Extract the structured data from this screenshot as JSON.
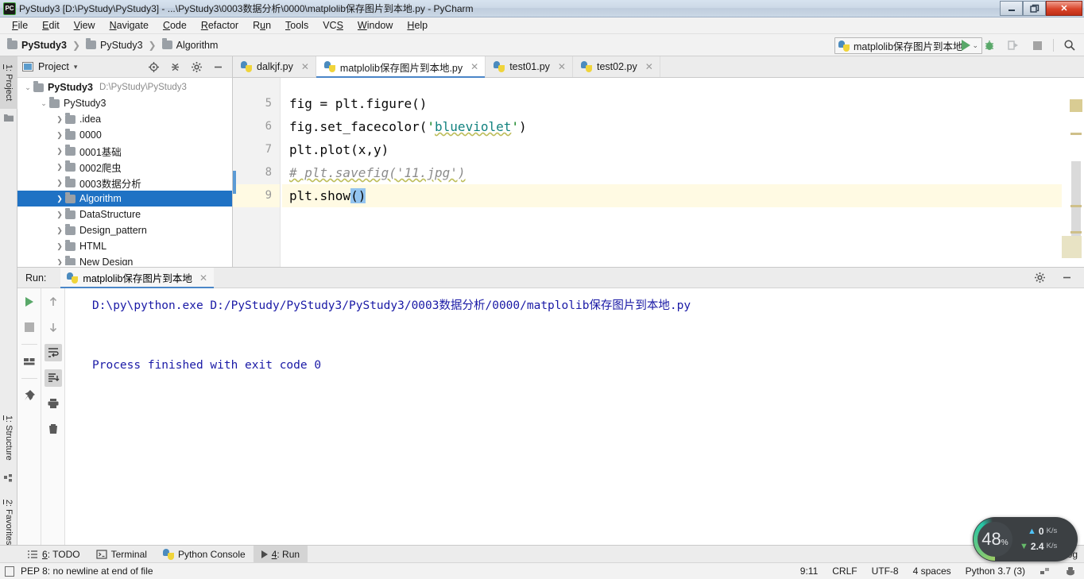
{
  "window": {
    "title": "PyStudy3 [D:\\PyStudy\\PyStudy3] - ...\\PyStudy3\\0003数据分析\\0000\\matplolib保存图片到本地.py - PyCharm",
    "app_icon": "PC",
    "minimize_label": "—",
    "restore_label": "❐",
    "close_label": "✕"
  },
  "menubar": {
    "items": [
      {
        "label": "File",
        "mnemonic": "F"
      },
      {
        "label": "Edit",
        "mnemonic": "E"
      },
      {
        "label": "View",
        "mnemonic": "V"
      },
      {
        "label": "Navigate",
        "mnemonic": "N"
      },
      {
        "label": "Code",
        "mnemonic": "C"
      },
      {
        "label": "Refactor",
        "mnemonic": "R"
      },
      {
        "label": "Run",
        "mnemonic": "u"
      },
      {
        "label": "Tools",
        "mnemonic": "T"
      },
      {
        "label": "VCS",
        "mnemonic": "S"
      },
      {
        "label": "Window",
        "mnemonic": "W"
      },
      {
        "label": "Help",
        "mnemonic": "H"
      }
    ]
  },
  "breadcrumb": {
    "items": [
      "PyStudy3",
      "PyStudy3",
      "Algorithm"
    ],
    "separator": "❯"
  },
  "run_config": {
    "name": "matplolib保存图片到本地",
    "chevron": "⌄",
    "icon": "python-icon"
  },
  "nav_actions": [
    {
      "name": "run-button",
      "icon": "play-icon"
    },
    {
      "name": "debug-button",
      "icon": "bug-icon"
    },
    {
      "name": "run-coverage-button",
      "icon": "coverage-icon"
    },
    {
      "name": "stop-button",
      "icon": "stop-icon"
    },
    {
      "name": "search-everywhere-button",
      "icon": "search-icon"
    }
  ],
  "left_strip": {
    "top": {
      "label": "1: Project",
      "mnemonic": "1"
    },
    "bottom": [
      {
        "label": "1: Structure",
        "mnemonic": "1"
      },
      {
        "label": "2: Favorites",
        "mnemonic": "2"
      }
    ]
  },
  "project_panel": {
    "title": "Project",
    "dropdown": "▾",
    "tools": [
      {
        "name": "locate-icon",
        "label": "Select Opened File"
      },
      {
        "name": "collapse-all-icon",
        "label": "Collapse All"
      },
      {
        "name": "gear-icon",
        "label": "Settings"
      },
      {
        "name": "hide-icon",
        "label": "Hide"
      }
    ],
    "tree": [
      {
        "indent": 0,
        "arrow": "⌄",
        "label": "PyStudy3",
        "bold": true,
        "path": "D:\\PyStudy\\PyStudy3",
        "selected": false
      },
      {
        "indent": 1,
        "arrow": "⌄",
        "label": "PyStudy3",
        "bold": false,
        "path": "",
        "selected": false
      },
      {
        "indent": 2,
        "arrow": "❯",
        "label": ".idea",
        "bold": false,
        "path": "",
        "selected": false
      },
      {
        "indent": 2,
        "arrow": "❯",
        "label": "0000",
        "bold": false,
        "path": "",
        "selected": false
      },
      {
        "indent": 2,
        "arrow": "❯",
        "label": "0001基础",
        "bold": false,
        "path": "",
        "selected": false
      },
      {
        "indent": 2,
        "arrow": "❯",
        "label": "0002爬虫",
        "bold": false,
        "path": "",
        "selected": false
      },
      {
        "indent": 2,
        "arrow": "❯",
        "label": "0003数据分析",
        "bold": false,
        "path": "",
        "selected": false
      },
      {
        "indent": 2,
        "arrow": "❯",
        "label": "Algorithm",
        "bold": false,
        "path": "",
        "selected": true
      },
      {
        "indent": 2,
        "arrow": "❯",
        "label": "DataStructure",
        "bold": false,
        "path": "",
        "selected": false
      },
      {
        "indent": 2,
        "arrow": "❯",
        "label": "Design_pattern",
        "bold": false,
        "path": "",
        "selected": false
      },
      {
        "indent": 2,
        "arrow": "❯",
        "label": "HTML",
        "bold": false,
        "path": "",
        "selected": false
      },
      {
        "indent": 2,
        "arrow": "❯",
        "label": "New Design",
        "bold": false,
        "path": "",
        "selected": false
      }
    ]
  },
  "editor": {
    "tabs": [
      {
        "label": "dalkjf.py",
        "active": false,
        "close": "✕"
      },
      {
        "label": "matplolib保存图片到本地.py",
        "active": true,
        "close": "✕"
      },
      {
        "label": "test01.py",
        "active": false,
        "close": "✕"
      },
      {
        "label": "test02.py",
        "active": false,
        "close": "✕"
      }
    ],
    "line_numbers": [
      "5",
      "6",
      "7",
      "8",
      "9"
    ],
    "lines": [
      {
        "num": "5",
        "text": "fig = plt.figure()",
        "current": false
      },
      {
        "num": "6",
        "text": "fig.set_facecolor('blueviolet')",
        "current": false
      },
      {
        "num": "7",
        "text": "plt.plot(x,y)",
        "current": false
      },
      {
        "num": "8",
        "text": "# plt.savefig('11.jpg')",
        "current": false
      },
      {
        "num": "9",
        "text": "plt.show()",
        "current": true
      }
    ],
    "code_tokens": {
      "l5_a": "fig = plt.figure()",
      "l6_a": "fig.set_facecolor(",
      "l6_q1": "'",
      "l6_str": "blueviolet",
      "l6_q2": "'",
      "l6_b": ")",
      "l7_a": "plt.plot(x,y)",
      "l8_comment": "# plt.savefig('11.jpg')",
      "l9_a": "plt.show",
      "l9_sel": "()"
    }
  },
  "run_panel": {
    "label": "Run:",
    "tab_name": "matplolib保存图片到本地",
    "tab_close": "✕",
    "header_tools": [
      {
        "name": "gear-icon"
      },
      {
        "name": "hide-icon"
      }
    ],
    "toolbar": [
      {
        "name": "rerun-button",
        "icon": "play-icon"
      },
      {
        "name": "stop-button",
        "icon": "stop-icon"
      },
      {
        "name": "layout-button",
        "icon": "layout-icon"
      },
      {
        "name": "pin-button",
        "icon": "pin-icon"
      },
      {
        "name": "up-button",
        "icon": "arrow-up-icon"
      },
      {
        "name": "down-button",
        "icon": "arrow-down-icon"
      },
      {
        "name": "soft-wrap-button",
        "icon": "wrap-icon"
      },
      {
        "name": "scroll-to-end-button",
        "icon": "scroll-end-icon"
      },
      {
        "name": "print-button",
        "icon": "printer-icon"
      },
      {
        "name": "clear-all-button",
        "icon": "trash-icon"
      }
    ],
    "console_lines": [
      "D:\\py\\python.exe D:/PyStudy/PyStudy3/PyStudy3/0003数据分析/0000/matplolib保存图片到本地.py",
      "",
      "Process finished with exit code 0"
    ]
  },
  "bottom_bar": {
    "items": [
      {
        "label": "6: TODO",
        "mnemonic": "6",
        "icon": "list-icon",
        "active": false
      },
      {
        "label": "Terminal",
        "mnemonic": "",
        "icon": "terminal-icon",
        "active": false
      },
      {
        "label": "Python Console",
        "mnemonic": "",
        "icon": "python-console-icon",
        "active": false
      },
      {
        "label": "4: Run",
        "mnemonic": "4",
        "icon": "play-icon",
        "active": true
      }
    ],
    "event_log": "Event Log"
  },
  "statusbar": {
    "message": "PEP 8: no newline at end of file",
    "right": [
      {
        "name": "caret-position",
        "text": "9:11"
      },
      {
        "name": "line-separator",
        "text": "CRLF"
      },
      {
        "name": "file-encoding",
        "text": "UTF-8"
      },
      {
        "name": "indent-setting",
        "text": "4 spaces"
      },
      {
        "name": "python-interpreter",
        "text": "Python 3.7 (3)"
      }
    ]
  },
  "cpu_widget": {
    "percent": "48",
    "percent_unit": "%",
    "upload_value": "0",
    "upload_unit": "K/s",
    "upload_arrow": "▲",
    "download_value": "2.4",
    "download_unit": "K/s",
    "download_arrow": "▼"
  },
  "colors": {
    "accent": "#4a86c8",
    "selection": "#1f72c4",
    "console_text": "#1a1aa6",
    "string": "#067d17",
    "teal": "#12827f",
    "comment": "#8c8c8c",
    "current_line": "#fffae3",
    "close_button": "#d9442a"
  }
}
